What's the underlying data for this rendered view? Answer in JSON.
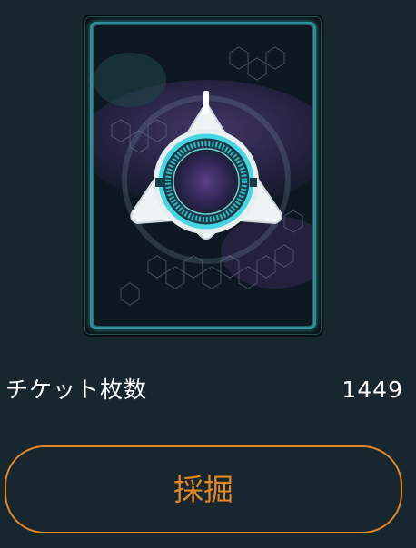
{
  "card": {
    "icon": "triangular-reactor-emblem-icon",
    "accent_color": "#2f8f98",
    "glow_color": "#5fe0e8"
  },
  "tickets": {
    "label": "チケット枚数",
    "count": "1449"
  },
  "actions": {
    "mine_label": "採掘",
    "button_color": "#e08826"
  }
}
